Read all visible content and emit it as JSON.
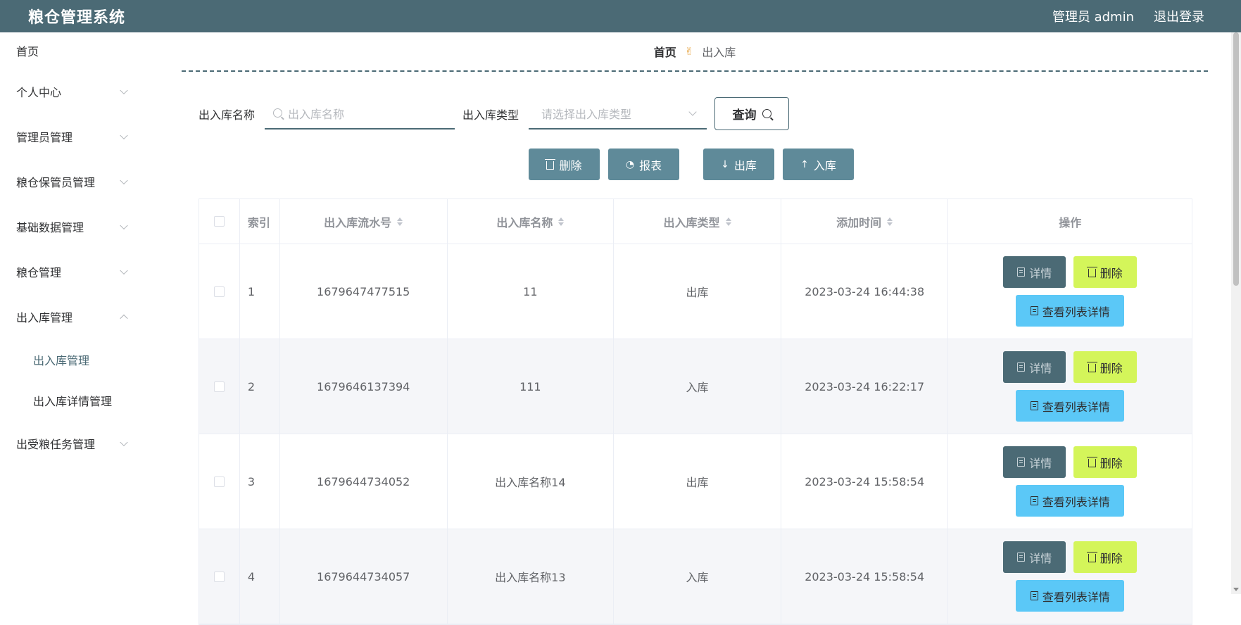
{
  "header": {
    "title": "粮仓管理系统",
    "user_label": "管理员 admin",
    "logout_label": "退出登录"
  },
  "sidebar": {
    "items": [
      {
        "label": "首页",
        "expandable": false
      },
      {
        "label": "个人中心",
        "expandable": true
      },
      {
        "label": "管理员管理",
        "expandable": true
      },
      {
        "label": "粮仓保管员管理",
        "expandable": true
      },
      {
        "label": "基础数据管理",
        "expandable": true
      },
      {
        "label": "粮仓管理",
        "expandable": true
      },
      {
        "label": "出入库管理",
        "expandable": true,
        "expanded": true
      },
      {
        "label": "出受粮任务管理",
        "expandable": true
      }
    ],
    "sub_items": [
      {
        "label": "出入库管理",
        "active": true
      },
      {
        "label": "出入库详情管理",
        "active": false
      }
    ]
  },
  "breadcrumb": {
    "home": "首页",
    "separator_icon": "hand-icon",
    "current": "出入库"
  },
  "search": {
    "name_label": "出入库名称",
    "name_placeholder": "出入库名称",
    "type_label": "出入库类型",
    "type_placeholder": "请选择出入库类型",
    "query_label": "查询"
  },
  "actions": {
    "delete_label": "删除",
    "report_label": "报表",
    "out_label": "出库",
    "in_label": "入库"
  },
  "table": {
    "columns": [
      "索引",
      "出入库流水号",
      "出入库名称",
      "出入库类型",
      "添加时间",
      "操作"
    ],
    "rows": [
      {
        "index": "1",
        "serial": "1679647477515",
        "name": "11",
        "type": "出库",
        "time": "2023-03-24 16:44:38"
      },
      {
        "index": "2",
        "serial": "1679646137394",
        "name": "111",
        "type": "入库",
        "time": "2023-03-24 16:22:17"
      },
      {
        "index": "3",
        "serial": "1679644734052",
        "name": "出入库名称14",
        "type": "出库",
        "time": "2023-03-24 15:58:54"
      },
      {
        "index": "4",
        "serial": "1679644734057",
        "name": "出入库名称13",
        "type": "入库",
        "time": "2023-03-24 15:58:54"
      }
    ],
    "op_detail": "详情",
    "op_delete": "删除",
    "op_list_detail": "查看列表详情"
  },
  "colors": {
    "header_bg": "#4b6a75",
    "action_button": "#5f8a99",
    "delete_button": "#d4f55a",
    "list_button": "#5bc8f7"
  }
}
